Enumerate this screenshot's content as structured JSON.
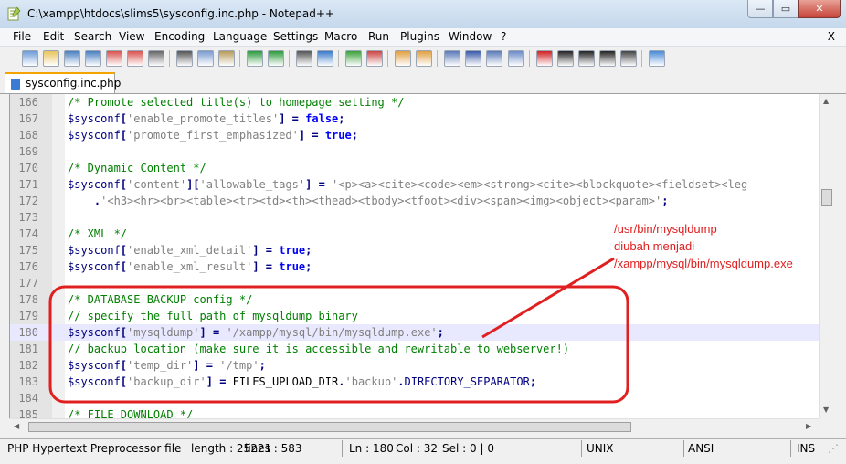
{
  "window": {
    "title": "C:\\xampp\\htdocs\\slims5\\sysconfig.inc.php - Notepad++",
    "min_symbol": "—",
    "max_symbol": "▭",
    "close_symbol": "✕"
  },
  "menu": {
    "items": [
      "File",
      "Edit",
      "Search",
      "View",
      "Encoding",
      "Language",
      "Settings",
      "Macro",
      "Run",
      "Plugins",
      "Window",
      "?"
    ],
    "close": "X"
  },
  "toolbar": {
    "icons": [
      "new-file-icon",
      "open-file-icon",
      "save-icon",
      "save-all-icon",
      "close-icon",
      "close-all-icon",
      "print-icon",
      "cut-icon",
      "copy-icon",
      "paste-icon",
      "undo-icon",
      "redo-icon",
      "find-icon",
      "replace-icon",
      "zoom-in-icon",
      "zoom-out-icon",
      "sync-vertical-icon",
      "sync-horizontal-icon",
      "word-wrap-icon",
      "show-all-chars-icon",
      "indent-guide-icon",
      "doc-map-icon",
      "record-macro-icon",
      "stop-macro-icon",
      "play-macro-icon",
      "play-multiple-icon",
      "save-macro-icon",
      "spellcheck-icon"
    ]
  },
  "tab": {
    "label": "sysconfig.inc.php"
  },
  "editor": {
    "lines": [
      {
        "num": "166",
        "tokens": [
          [
            "cm",
            "/* Promote selected title(s) to homepage setting */"
          ]
        ]
      },
      {
        "num": "167",
        "tokens": [
          [
            "var",
            "$sysconf"
          ],
          [
            "op",
            "["
          ],
          [
            "str",
            "'enable_promote_titles'"
          ],
          [
            "op",
            "]"
          ],
          [
            "txt",
            " "
          ],
          [
            "op",
            "="
          ],
          [
            "txt",
            " "
          ],
          [
            "kw",
            "false"
          ],
          [
            "op",
            ";"
          ]
        ]
      },
      {
        "num": "168",
        "tokens": [
          [
            "var",
            "$sysconf"
          ],
          [
            "op",
            "["
          ],
          [
            "str",
            "'promote_first_emphasized'"
          ],
          [
            "op",
            "]"
          ],
          [
            "txt",
            " "
          ],
          [
            "op",
            "="
          ],
          [
            "txt",
            " "
          ],
          [
            "kw",
            "true"
          ],
          [
            "op",
            ";"
          ]
        ]
      },
      {
        "num": "169",
        "tokens": []
      },
      {
        "num": "170",
        "tokens": [
          [
            "cm",
            "/* Dynamic Content */"
          ]
        ]
      },
      {
        "num": "171",
        "tokens": [
          [
            "var",
            "$sysconf"
          ],
          [
            "op",
            "["
          ],
          [
            "str",
            "'content'"
          ],
          [
            "op",
            "]["
          ],
          [
            "str",
            "'allowable_tags'"
          ],
          [
            "op",
            "]"
          ],
          [
            "txt",
            " "
          ],
          [
            "op",
            "="
          ],
          [
            "txt",
            " "
          ],
          [
            "str",
            "'<p><a><cite><code><em><strong><cite><blockquote><fieldset><leg"
          ]
        ]
      },
      {
        "num": "172",
        "tokens": [
          [
            "txt",
            "    "
          ],
          [
            "op",
            "."
          ],
          [
            "str",
            "'<h3><hr><br><table><tr><td><th><thead><tbody><tfoot><div><span><img><object><param>'"
          ],
          [
            "op",
            ";"
          ]
        ]
      },
      {
        "num": "173",
        "tokens": []
      },
      {
        "num": "174",
        "tokens": [
          [
            "cm",
            "/* XML */"
          ]
        ]
      },
      {
        "num": "175",
        "tokens": [
          [
            "var",
            "$sysconf"
          ],
          [
            "op",
            "["
          ],
          [
            "str",
            "'enable_xml_detail'"
          ],
          [
            "op",
            "]"
          ],
          [
            "txt",
            " "
          ],
          [
            "op",
            "="
          ],
          [
            "txt",
            " "
          ],
          [
            "kw",
            "true"
          ],
          [
            "op",
            ";"
          ]
        ]
      },
      {
        "num": "176",
        "tokens": [
          [
            "var",
            "$sysconf"
          ],
          [
            "op",
            "["
          ],
          [
            "str",
            "'enable_xml_result'"
          ],
          [
            "op",
            "]"
          ],
          [
            "txt",
            " "
          ],
          [
            "op",
            "="
          ],
          [
            "txt",
            " "
          ],
          [
            "kw",
            "true"
          ],
          [
            "op",
            ";"
          ]
        ]
      },
      {
        "num": "177",
        "tokens": []
      },
      {
        "num": "178",
        "tokens": [
          [
            "cm",
            "/* DATABASE BACKUP config */"
          ]
        ]
      },
      {
        "num": "179",
        "tokens": [
          [
            "cm",
            "// specify the full path of mysqldump binary"
          ]
        ]
      },
      {
        "num": "180",
        "current": true,
        "tokens": [
          [
            "var",
            "$sysconf"
          ],
          [
            "op",
            "["
          ],
          [
            "str",
            "'mysqldump'"
          ],
          [
            "op",
            "]"
          ],
          [
            "txt",
            " "
          ],
          [
            "op",
            "="
          ],
          [
            "txt",
            " "
          ],
          [
            "str",
            "'/xampp/mysql/bin/mysqldump.exe'"
          ],
          [
            "op",
            ";"
          ]
        ]
      },
      {
        "num": "181",
        "tokens": [
          [
            "cm",
            "// backup location (make sure it is accessible and rewritable to webserver!)"
          ]
        ]
      },
      {
        "num": "182",
        "tokens": [
          [
            "var",
            "$sysconf"
          ],
          [
            "op",
            "["
          ],
          [
            "str",
            "'temp_dir'"
          ],
          [
            "op",
            "]"
          ],
          [
            "txt",
            " "
          ],
          [
            "op",
            "="
          ],
          [
            "txt",
            " "
          ],
          [
            "str",
            "'/tmp'"
          ],
          [
            "op",
            ";"
          ]
        ]
      },
      {
        "num": "183",
        "tokens": [
          [
            "var",
            "$sysconf"
          ],
          [
            "op",
            "["
          ],
          [
            "str",
            "'backup_dir'"
          ],
          [
            "op",
            "]"
          ],
          [
            "txt",
            " "
          ],
          [
            "op",
            "="
          ],
          [
            "txt",
            " FILES_UPLOAD_DIR"
          ],
          [
            "op",
            "."
          ],
          [
            "str",
            "'backup'"
          ],
          [
            "op",
            "."
          ],
          [
            "const",
            "DIRECTORY_SEPARATOR"
          ],
          [
            "op",
            ";"
          ]
        ]
      },
      {
        "num": "184",
        "tokens": []
      },
      {
        "num": "185",
        "tokens": [
          [
            "cm",
            "/* FILE DOWNLOAD */"
          ]
        ]
      }
    ]
  },
  "annotation": {
    "lines": [
      "/usr/bin/mysqldump",
      "diubah menjadi",
      "/xampp/mysql/bin/mysqldump.exe"
    ],
    "color": "#e02020"
  },
  "status": {
    "filetype": "PHP Hypertext Preprocessor file",
    "length": "length : 25221",
    "lines": "lines : 583",
    "ln": "Ln : 180",
    "col": "Col : 32",
    "sel": "Sel : 0 | 0",
    "eol": "UNIX",
    "encoding": "ANSI",
    "mode": "INS"
  },
  "colors": {
    "comment": "#008000",
    "variable": "#000080",
    "string": "#808080",
    "keyword": "#0000ff",
    "current_line": "#e8e8ff",
    "tab_accent": "#f5a300"
  }
}
